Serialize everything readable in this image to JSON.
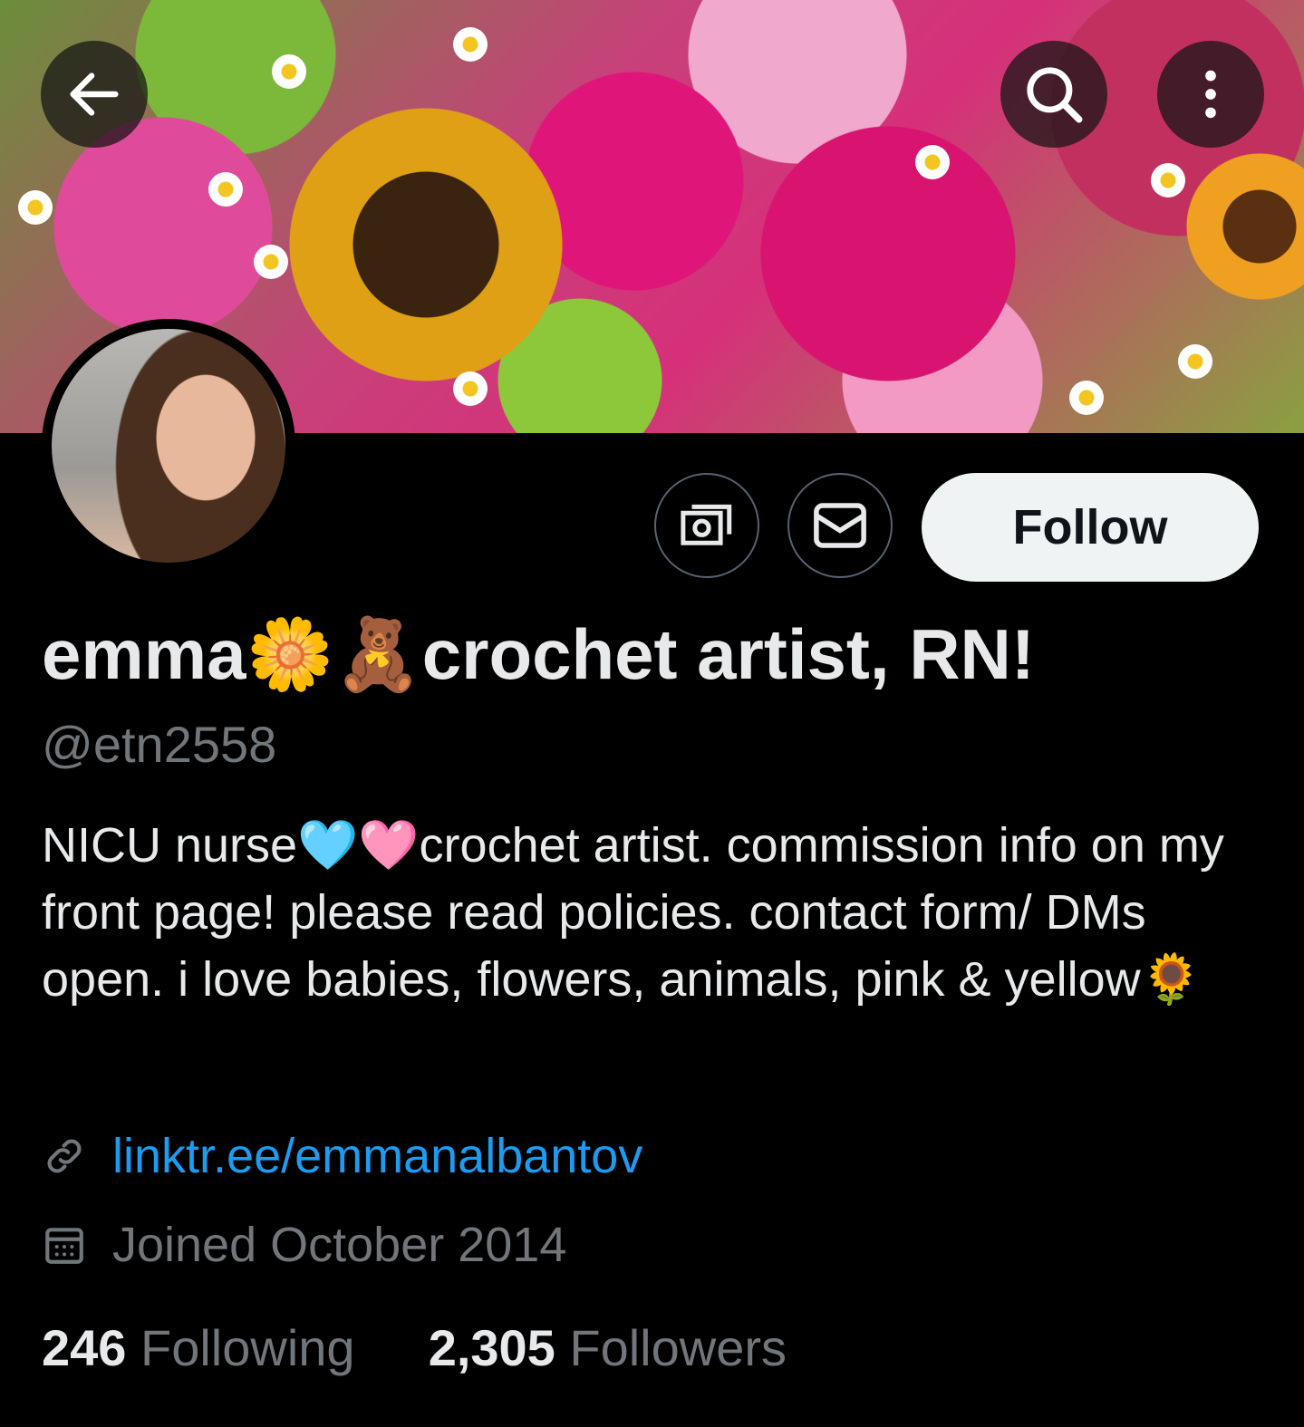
{
  "header": {
    "back_icon": "arrow-left-icon",
    "search_icon": "search-icon",
    "more_icon": "more-vertical-icon"
  },
  "actions": {
    "subscribe_icon": "money-icon",
    "message_icon": "mail-icon",
    "follow_label": "Follow"
  },
  "profile": {
    "name": "emma🌼🧸crochet artist, RN!",
    "handle": "@etn2558",
    "bio": "NICU nurse🩵🩷crochet artist. commission info on my front page! please read policies. contact form/ DMs open. i love babies, flowers, animals, pink & yellow🌻",
    "link": "linktr.ee/emmanalbantov",
    "joined": "Joined October 2014"
  },
  "stats": {
    "following_count": "246",
    "following_label": "Following",
    "followers_count": "2,305",
    "followers_label": "Followers"
  },
  "colors": {
    "background": "#000000",
    "link": "#1d9bf0",
    "secondary_text": "#71767b",
    "follow_button": "#eff3f4"
  }
}
